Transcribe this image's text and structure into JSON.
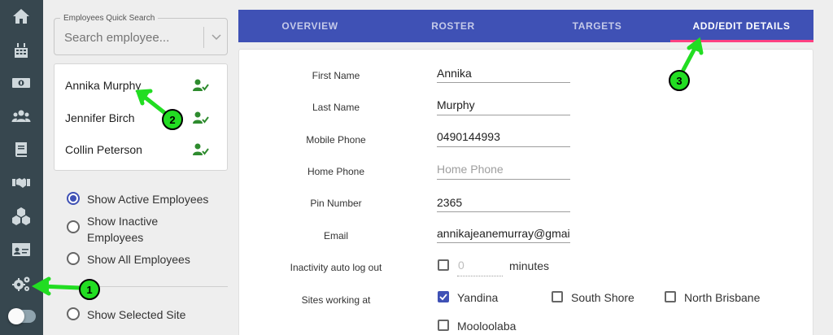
{
  "sidebar": {
    "icons": [
      "home-icon",
      "calendar-icon",
      "money-icon",
      "users-icon",
      "book-icon",
      "handshake-icon",
      "boxes-icon",
      "id-card-icon",
      "gears-icon"
    ],
    "toggle_on": false
  },
  "search": {
    "legend": "Employees Quick Search",
    "placeholder": "Search employee..."
  },
  "employees": [
    {
      "name": "Annika Murphy"
    },
    {
      "name": "Jennifer Birch"
    },
    {
      "name": "Collin Peterson"
    }
  ],
  "filters": {
    "active": "Show Active Employees",
    "inactive": "Show Inactive Employees",
    "all": "Show All Employees",
    "site": "Show Selected Site",
    "selected": "active"
  },
  "tabs": {
    "overview": "OVERVIEW",
    "roster": "ROSTER",
    "targets": "TARGETS",
    "details": "ADD/EDIT DETAILS",
    "active": "details"
  },
  "form": {
    "first_name": {
      "label": "First Name",
      "value": "Annika"
    },
    "last_name": {
      "label": "Last Name",
      "value": "Murphy"
    },
    "mobile": {
      "label": "Mobile Phone",
      "value": "0490144993"
    },
    "home": {
      "label": "Home Phone",
      "placeholder": "Home Phone"
    },
    "pin": {
      "label": "Pin Number",
      "value": "2365"
    },
    "email": {
      "label": "Email",
      "value": "annikajeanemurray@gmail.com"
    },
    "inactivity": {
      "label": "Inactivity auto log out",
      "value": "0",
      "unit": "minutes"
    },
    "sites": {
      "label": "Sites working at",
      "yandina": "Yandina",
      "south_shore": "South Shore",
      "north_brisbane": "North Brisbane",
      "mooloolaba": "Mooloolaba"
    }
  },
  "annotations": {
    "one": "1",
    "two": "2",
    "three": "3"
  },
  "colors": {
    "primary": "#3f51b5",
    "sidebar": "#37474f",
    "accent": "#ff4081",
    "annotation": "#22dd22"
  }
}
